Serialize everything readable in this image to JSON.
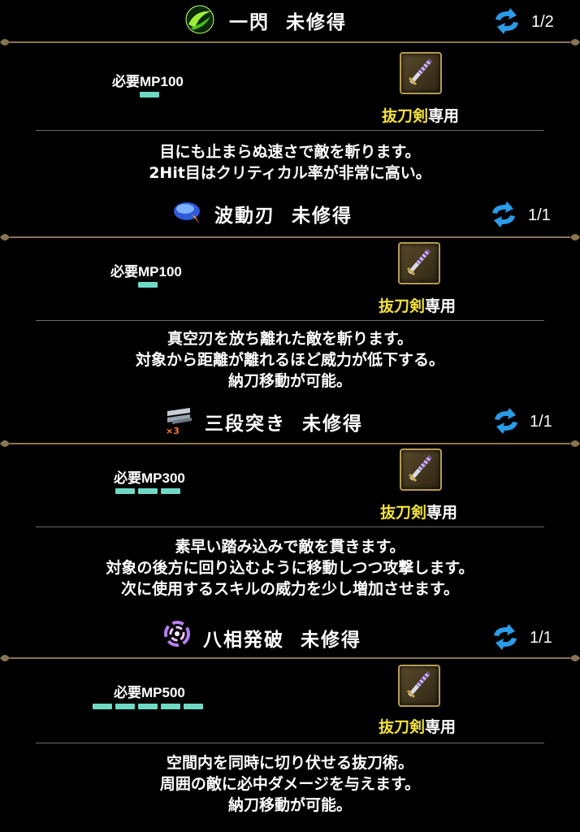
{
  "skills": [
    {
      "icon": "slash-swirl-icon",
      "name": "一閃",
      "status": "未修得",
      "counter": "1/2",
      "mp_label": "必要MP100",
      "mp_cost_segments": 1,
      "weapon_icon": "katana-icon",
      "weapon_name": "抜刀剣",
      "weapon_suffix": "専用",
      "description": [
        "目にも止まらぬ速さで敵を斬ります。",
        "2Hit目はクリティカル率が非常に高い。"
      ]
    },
    {
      "icon": "wave-blade-icon",
      "name": "波動刃",
      "status": "未修得",
      "counter": "1/1",
      "mp_label": "必要MP100",
      "mp_cost_segments": 1,
      "weapon_icon": "katana-icon",
      "weapon_name": "抜刀剣",
      "weapon_suffix": "専用",
      "description": [
        "真空刃を放ち離れた敵を斬ります。",
        "対象から距離が離れるほど威力が低下する。",
        "納刀移動が可能。"
      ]
    },
    {
      "icon": "triple-thrust-icon",
      "name": "三段突き",
      "status": "未修得",
      "counter": "1/1",
      "mp_label": "必要MP300",
      "mp_cost_segments": 3,
      "weapon_icon": "katana-icon",
      "weapon_name": "抜刀剣",
      "weapon_suffix": "専用",
      "description": [
        "素早い踏み込みで敵を貫きます。",
        "対象の後方に回り込むように移動しつつ攻撃します。",
        "次に使用するスキルの威力を少し増加させます。"
      ]
    },
    {
      "icon": "hasso-burst-icon",
      "name": "八相発破",
      "status": "未修得",
      "counter": "1/1",
      "mp_label": "必要MP500",
      "mp_cost_segments": 5,
      "weapon_icon": "katana-icon",
      "weapon_name": "抜刀剣",
      "weapon_suffix": "専用",
      "description": [
        "空間内を同時に切り伏せる抜刀術。",
        "周囲の敵に必中ダメージを与えます。",
        "納刀移動が可能。"
      ]
    }
  ],
  "colors": {
    "background": "#000000",
    "weapon_name": "#f3e23a",
    "mp_bar": "#6fd9c4",
    "divider": "#6b6b6b",
    "ornament": "#8a7552"
  }
}
